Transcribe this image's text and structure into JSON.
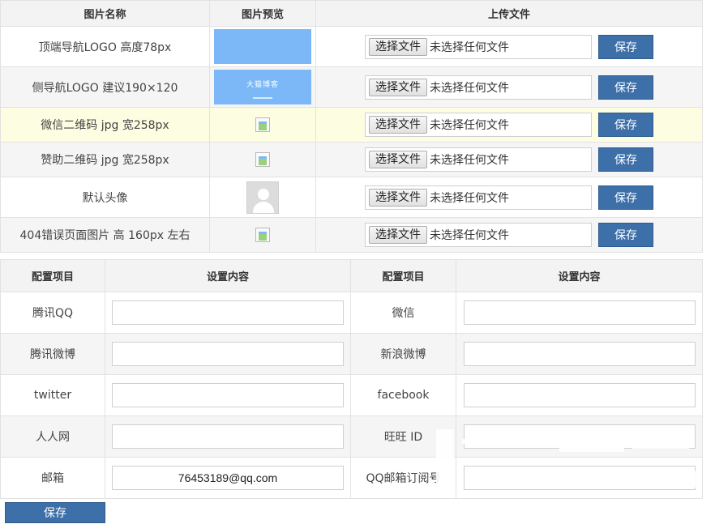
{
  "upload": {
    "headers": {
      "name": "图片名称",
      "preview": "图片预览",
      "upload": "上传文件"
    },
    "choose_label": "选择文件",
    "no_file_label": "未选择任何文件",
    "save_label": "保存",
    "rows": [
      {
        "name": "顶端导航LOGO 高度78px",
        "preview": "logo-image"
      },
      {
        "name": "侧导航LOGO 建议190×120",
        "preview": "side-logo-image"
      },
      {
        "name": "微信二维码 jpg 宽258px",
        "preview": "broken-image"
      },
      {
        "name": "赞助二维码 jpg 宽258px",
        "preview": "broken-image"
      },
      {
        "name": "默认头像",
        "preview": "avatar-image"
      },
      {
        "name": "404错误页面图片 高 160px 左右",
        "preview": "broken-image"
      }
    ],
    "side_logo_text": "大猫博客"
  },
  "config": {
    "headers": {
      "item": "配置项目",
      "content": "设置内容",
      "item2": "配置项目",
      "content2": "设置内容"
    },
    "rows": [
      {
        "left_label": "腾讯QQ",
        "left_value": "",
        "right_label": "微信",
        "right_value": ""
      },
      {
        "left_label": "腾讯微博",
        "left_value": "",
        "right_label": "新浪微博",
        "right_value": ""
      },
      {
        "left_label": "twitter",
        "left_value": "",
        "right_label": "facebook",
        "right_value": ""
      },
      {
        "left_label": "人人网",
        "left_value": "",
        "right_label": "旺旺 ID",
        "right_value": ""
      },
      {
        "left_label": "邮箱",
        "left_value": "76453189@qq.com",
        "right_label": "QQ邮箱订阅号",
        "right_value": ""
      }
    ]
  },
  "footer": {
    "save_label": "保存"
  },
  "colors": {
    "button": "#3d6fa8",
    "preview_blue": "#7cb8f7",
    "highlight_row": "#fdfde2"
  }
}
